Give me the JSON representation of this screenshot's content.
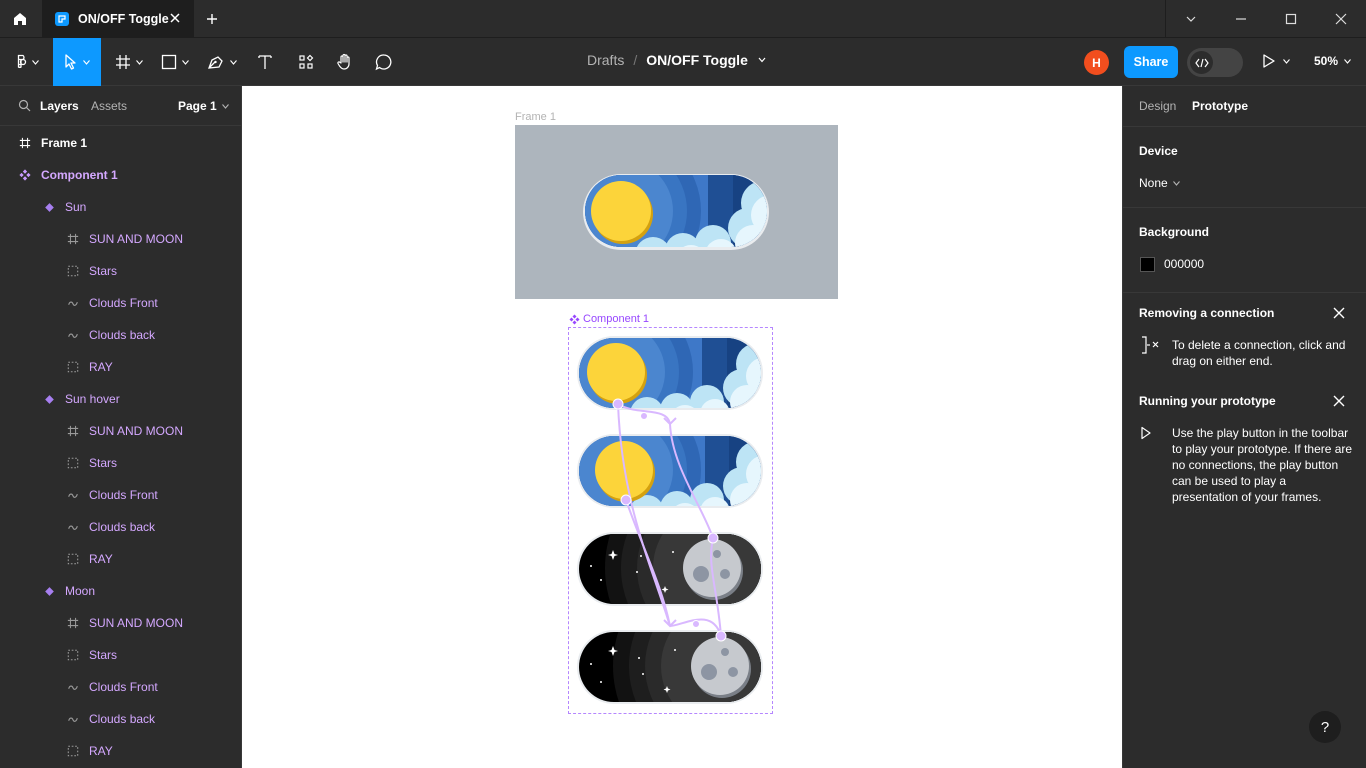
{
  "window": {
    "tab_title": "ON/OFF Toggle",
    "icons": [
      "home-icon",
      "figma-file-icon",
      "close-icon",
      "plus-icon",
      "chevron-down-icon",
      "minimize-icon",
      "maximize-icon",
      "close-window-icon"
    ]
  },
  "toolbar": {
    "breadcrumb_folder": "Drafts",
    "breadcrumb_separator": "/",
    "file_name": "ON/OFF Toggle",
    "avatar_initial": "H",
    "share_label": "Share",
    "zoom_label": "50%",
    "accent_color": "#0d99ff"
  },
  "left_panel": {
    "tab_layers": "Layers",
    "tab_assets": "Assets",
    "page_label": "Page 1",
    "layers": [
      {
        "label": "Frame 1",
        "type": "frame"
      },
      {
        "label": "Component 1",
        "type": "component"
      },
      {
        "label": "Sun",
        "type": "variant"
      },
      {
        "label": "SUN AND MOON",
        "type": "frame-child"
      },
      {
        "label": "Stars",
        "type": "group-child"
      },
      {
        "label": "Clouds Front",
        "type": "vector-child"
      },
      {
        "label": "Clouds back",
        "type": "vector-child"
      },
      {
        "label": "RAY",
        "type": "group-child"
      },
      {
        "label": "Sun hover",
        "type": "variant"
      },
      {
        "label": "SUN AND MOON",
        "type": "frame-child"
      },
      {
        "label": "Stars",
        "type": "group-child"
      },
      {
        "label": "Clouds Front",
        "type": "vector-child"
      },
      {
        "label": "Clouds back",
        "type": "vector-child"
      },
      {
        "label": "RAY",
        "type": "group-child"
      },
      {
        "label": "Moon",
        "type": "variant"
      },
      {
        "label": "SUN AND MOON",
        "type": "frame-child"
      },
      {
        "label": "Stars",
        "type": "group-child"
      },
      {
        "label": "Clouds Front",
        "type": "vector-child"
      },
      {
        "label": "Clouds back",
        "type": "vector-child"
      },
      {
        "label": "RAY",
        "type": "group-child"
      }
    ]
  },
  "canvas": {
    "frame_label": "Frame 1",
    "frame_bg": "#adb5bd",
    "component_label": "Component 1",
    "component_color": "#9747ff"
  },
  "right_panel": {
    "tab_design": "Design",
    "tab_prototype": "Prototype",
    "device_title": "Device",
    "device_value": "None",
    "background_title": "Background",
    "background_hex": "000000",
    "card1_title": "Removing a connection",
    "card1_text": "To delete a connection, click and drag on either end.",
    "card2_title": "Running your prototype",
    "card2_text": "Use the play button in the toolbar to play your prototype. If there are no connections, the play button can be used to play a presentation of your frames.",
    "help_label": "?"
  }
}
